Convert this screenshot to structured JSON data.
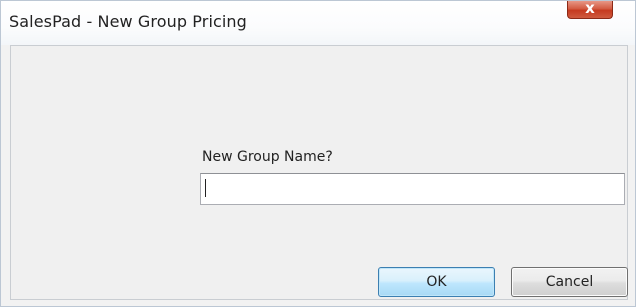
{
  "window": {
    "title": "SalesPad - New Group Pricing",
    "close_glyph": "x"
  },
  "form": {
    "prompt_label": "New Group Name?",
    "name_value": "",
    "name_placeholder": ""
  },
  "buttons": {
    "ok_label": "OK",
    "cancel_label": "Cancel"
  },
  "colors": {
    "close_button": "#c53a1f",
    "default_button_border": "#3c7fb1"
  }
}
